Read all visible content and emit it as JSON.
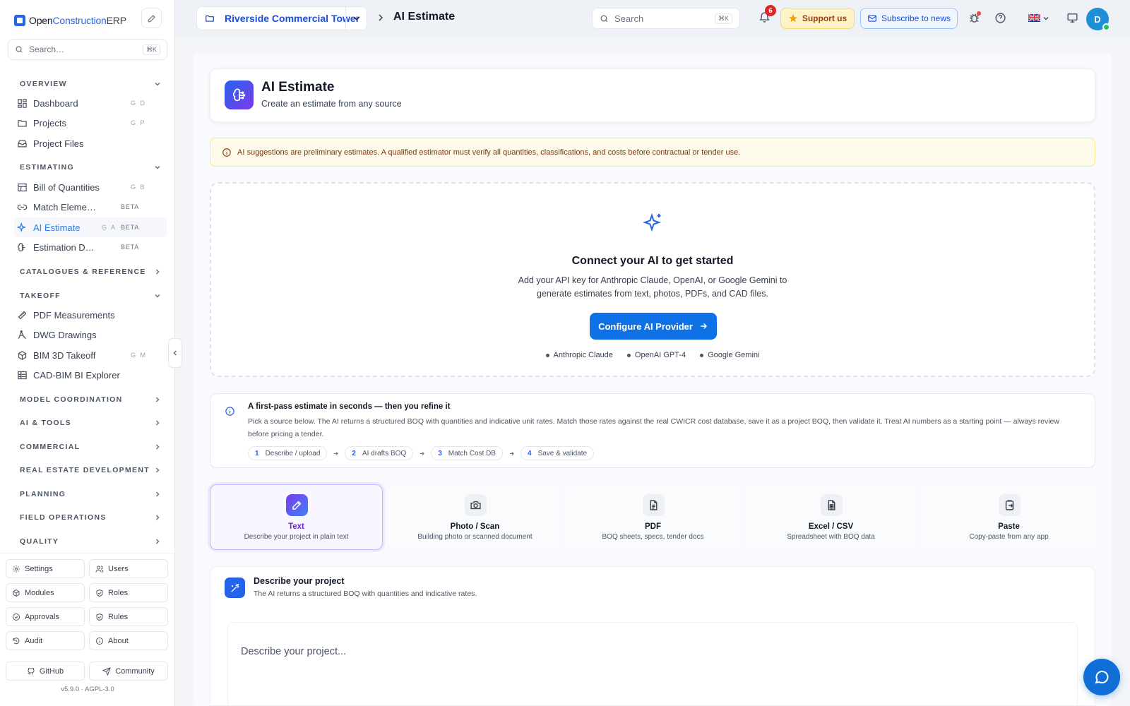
{
  "sidebar": {
    "logo": {
      "a": "Open",
      "b": "Construction",
      "c": "ERP"
    },
    "search": {
      "placeholder": "Search…",
      "shortcut": "⌘K"
    },
    "sections": {
      "overview": "OVERVIEW",
      "estimating": "ESTIMATING",
      "catalogues": "CATALOGUES & REFERENCE",
      "takeoff": "TAKEOFF",
      "model_coordination": "MODEL COORDINATION",
      "ai_tools": "AI & TOOLS",
      "commercial": "COMMERCIAL",
      "real_estate": "REAL ESTATE DEVELOPMENT",
      "planning": "PLANNING",
      "field_operations": "FIELD OPERATIONS",
      "quality": "QUALITY"
    },
    "items": {
      "dashboard": {
        "label": "Dashboard",
        "shortcut": "G D"
      },
      "projects": {
        "label": "Projects",
        "shortcut": "G P"
      },
      "project_files": {
        "label": "Project Files"
      },
      "boq": {
        "label": "Bill of Quantities",
        "shortcut": "G B"
      },
      "match": {
        "label": "Match Eleme…",
        "badge": "BETA"
      },
      "ai_estimate": {
        "label": "AI Estimate",
        "shortcut": "G A",
        "badge": "BETA"
      },
      "estimation_d": {
        "label": "Estimation D…",
        "badge": "BETA"
      },
      "pdf": {
        "label": "PDF Measurements"
      },
      "dwg": {
        "label": "DWG Drawings"
      },
      "bim": {
        "label": "BIM 3D Takeoff",
        "shortcut": "G M"
      },
      "cadbim": {
        "label": "CAD-BIM BI Explorer"
      }
    },
    "bottom": {
      "settings": "Settings",
      "users": "Users",
      "modules": "Modules",
      "roles": "Roles",
      "approvals": "Approvals",
      "rules": "Rules",
      "audit": "Audit",
      "about": "About",
      "github": "GitHub",
      "community": "Community"
    },
    "version": "v5.9.0  ·  AGPL-3.0"
  },
  "topbar": {
    "project": "Riverside Commercial Tower",
    "crumb": "AI Estimate",
    "search": {
      "placeholder": "Search",
      "shortcut": "⌘K"
    },
    "notifications": "6",
    "support": "Support us",
    "subscribe": "Subscribe to news",
    "avatar": "D"
  },
  "page": {
    "title": "AI Estimate",
    "subtitle": "Create an estimate from any source",
    "warning": "AI suggestions are preliminary estimates. A qualified estimator must verify all quantities, classifications, and costs before contractual or tender use.",
    "connect": {
      "title": "Connect your AI to get started",
      "desc1": "Add your API key for Anthropic Claude, OpenAI, or Google Gemini to",
      "desc2": "generate estimates from text, photos, PDFs, and CAD files.",
      "button": "Configure AI Provider",
      "providers": [
        "Anthropic Claude",
        "OpenAI GPT-4",
        "Google Gemini"
      ]
    },
    "firstpass": {
      "title": "A first-pass estimate in seconds — then you refine it",
      "text": "Pick a source below. The AI returns a structured BOQ with quantities and indicative unit rates. Match those rates against the real CWICR cost database, save it as a project BOQ, then validate it. Treat AI numbers as a starting point — always review before pricing a tender.",
      "steps": [
        {
          "n": "1",
          "label": "Describe / upload"
        },
        {
          "n": "2",
          "label": "AI drafts BOQ"
        },
        {
          "n": "3",
          "label": "Match Cost DB"
        },
        {
          "n": "4",
          "label": "Save & validate"
        }
      ]
    },
    "sources": [
      {
        "label": "Text",
        "desc": "Describe your project in plain text",
        "icon": "pencil-icon"
      },
      {
        "label": "Photo / Scan",
        "desc": "Building photo or scanned document",
        "icon": "camera-icon"
      },
      {
        "label": "PDF",
        "desc": "BOQ sheets, specs, tender docs",
        "icon": "file-text-icon"
      },
      {
        "label": "Excel / CSV",
        "desc": "Spreadsheet with BOQ data",
        "icon": "spreadsheet-icon"
      },
      {
        "label": "Paste",
        "desc": "Copy-paste from any app",
        "icon": "clipboard-icon"
      }
    ],
    "describe": {
      "title": "Describe your project",
      "subtitle": "The AI returns a structured BOQ with quantities and indicative rates.",
      "placeholder": "Describe your project...\n\nExample:"
    }
  },
  "colors": {
    "accent": "#0e72e6",
    "active_nav": "#2f7de1",
    "warning_bg": "#fffbeb",
    "selected_source": "#6d28d9"
  }
}
